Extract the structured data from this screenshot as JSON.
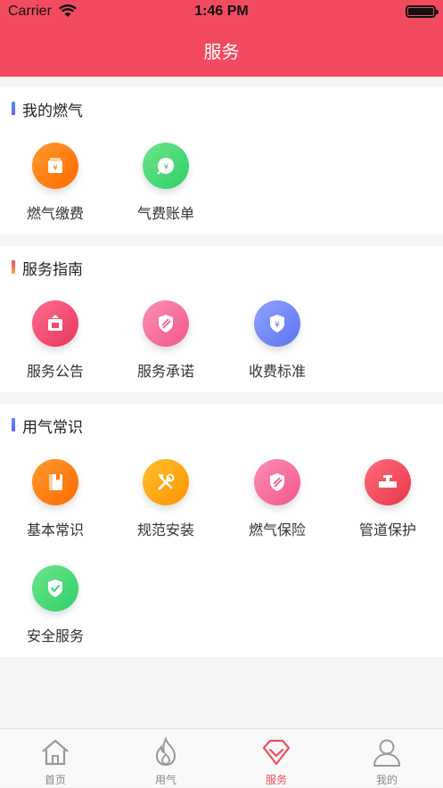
{
  "status_bar": {
    "carrier": "Carrier",
    "time": "1:46 PM"
  },
  "header": {
    "title": "服务"
  },
  "sections": [
    {
      "title": "我的燃气",
      "accent": "#4a6cf7",
      "items": [
        {
          "label": "燃气缴费",
          "icon": "yuan-wallet-icon"
        },
        {
          "label": "气费账单",
          "icon": "yuan-leaf-icon"
        }
      ]
    },
    {
      "title": "服务指南",
      "accent": "#f26a4b",
      "items": [
        {
          "label": "服务公告",
          "icon": "notice-board-icon"
        },
        {
          "label": "服务承诺",
          "icon": "shield-icon"
        },
        {
          "label": "收费标准",
          "icon": "yuan-shield-icon"
        }
      ]
    },
    {
      "title": "用气常识",
      "accent": "#4a6cf7",
      "items": [
        {
          "label": "基本常识",
          "icon": "book-icon"
        },
        {
          "label": "规范安装",
          "icon": "tools-icon"
        },
        {
          "label": "燃气保险",
          "icon": "shield-icon"
        },
        {
          "label": "管道保护",
          "icon": "pipe-valve-icon"
        },
        {
          "label": "安全服务",
          "icon": "check-shield-icon"
        }
      ]
    }
  ],
  "tabbar": {
    "items": [
      {
        "label": "首页",
        "icon": "home-icon"
      },
      {
        "label": "用气",
        "icon": "flame-icon"
      },
      {
        "label": "服务",
        "icon": "diamond-icon"
      },
      {
        "label": "我的",
        "icon": "user-icon"
      }
    ],
    "active_index": 2,
    "active_color": "#f24b5f"
  },
  "theme": {
    "primary": "#f24b5f"
  }
}
